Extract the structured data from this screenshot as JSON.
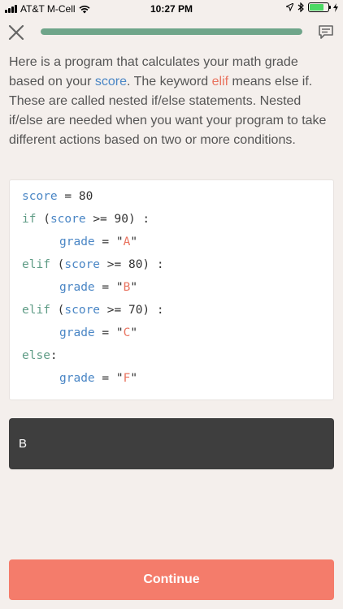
{
  "status_bar": {
    "carrier": "AT&T M-Cell",
    "time": "10:27 PM",
    "battery_level": 0.75
  },
  "header": {
    "close_icon": "close-icon",
    "progress": 1.0,
    "feedback_icon": "comment-icon"
  },
  "description": {
    "part1": "Here is a program that calculates your math grade based on your ",
    "score_word": "score",
    "part2": ". The keyword ",
    "elif_word": "elif",
    "part3": " means else if. These are called nested if/else statements. Nested if/else are needed when you want your program to take different actions based on two or more conditions."
  },
  "code": {
    "line1": {
      "var": "score",
      "rest": " = 80"
    },
    "line2": {
      "kw": "if",
      "open": " (",
      "var": "score",
      "rest": " >= 90) :"
    },
    "line3": {
      "var": "grade",
      "eq": " = \"",
      "str": "A",
      "close": "\""
    },
    "line4": {
      "kw": "elif",
      "open": " (",
      "var": "score",
      "rest": " >= 80) :"
    },
    "line5": {
      "var": "grade",
      "eq": " = \"",
      "str": "B",
      "close": "\""
    },
    "line6": {
      "kw": "elif",
      "open": " (",
      "var": "score",
      "rest": " >= 70) :"
    },
    "line7": {
      "var": "grade",
      "eq": " = \"",
      "str": "C",
      "close": "\""
    },
    "line8": {
      "kw": "else",
      "rest": ":"
    },
    "line9": {
      "var": "grade",
      "eq": " = \"",
      "str": "F",
      "close": "\""
    }
  },
  "output": {
    "value": "B"
  },
  "continue_label": "Continue",
  "colors": {
    "background": "#f4efec",
    "progress": "#6fa58a",
    "variable": "#4a86c5",
    "keyword": "#5f9c86",
    "string": "#e9735f",
    "output_bg": "#3e3e3e",
    "button": "#f47c6b"
  }
}
